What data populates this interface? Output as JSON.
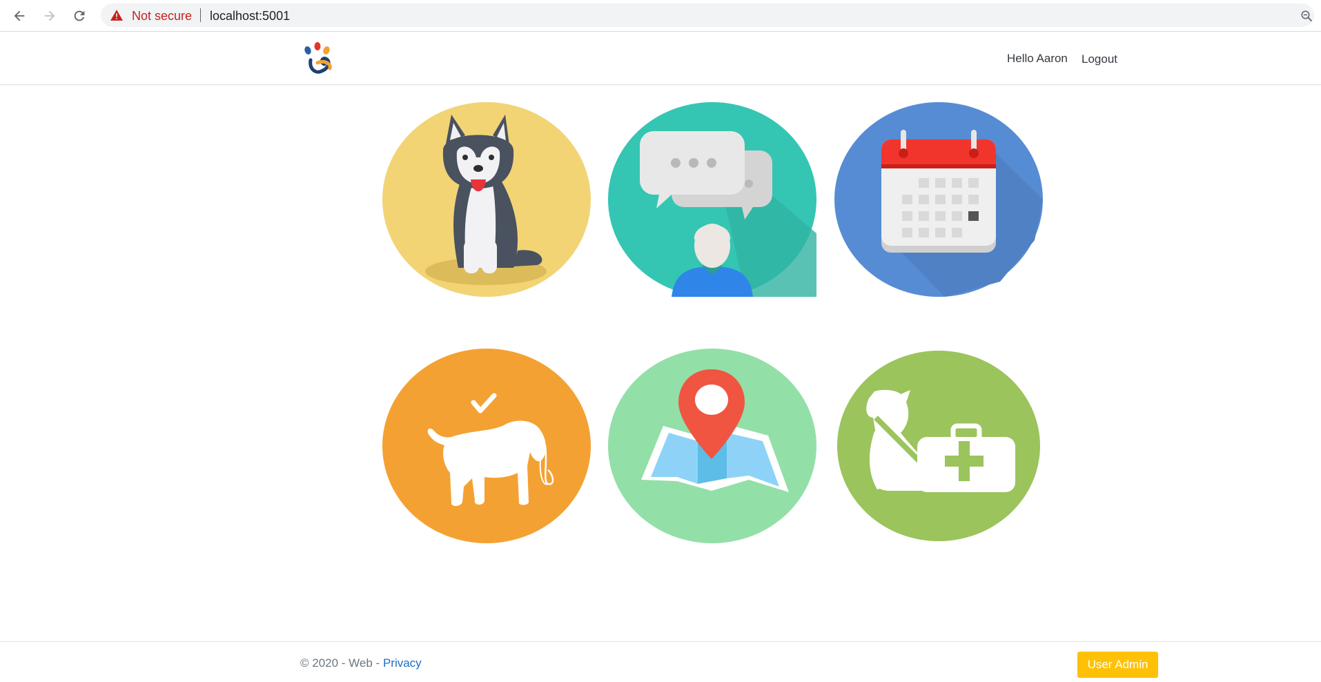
{
  "browser": {
    "security_label": "Not secure",
    "url": "localhost:5001"
  },
  "header": {
    "greeting": "Hello Aaron",
    "logout_label": "Logout"
  },
  "tiles": [
    {
      "name": "dog-profile",
      "icon": "husky-dog-icon",
      "color": "#f2d475"
    },
    {
      "name": "messages",
      "icon": "chat-bubbles-user-icon",
      "color": "#34c6b3"
    },
    {
      "name": "calendar",
      "icon": "calendar-icon",
      "color": "#568cd4"
    },
    {
      "name": "dog-walking",
      "icon": "dog-with-leash-icon",
      "color": "#f4a133"
    },
    {
      "name": "map",
      "icon": "map-pin-icon",
      "color": "#93dfa8"
    },
    {
      "name": "veterinary",
      "icon": "dog-medical-kit-icon",
      "color": "#9bc45c"
    }
  ],
  "footer": {
    "copyright": "© 2020 - Web - ",
    "privacy_label": "Privacy",
    "user_admin_label": "User Admin"
  },
  "colors": {
    "accent": "#ffc107",
    "link": "#1b6ec2",
    "warning": "#c5221f"
  }
}
